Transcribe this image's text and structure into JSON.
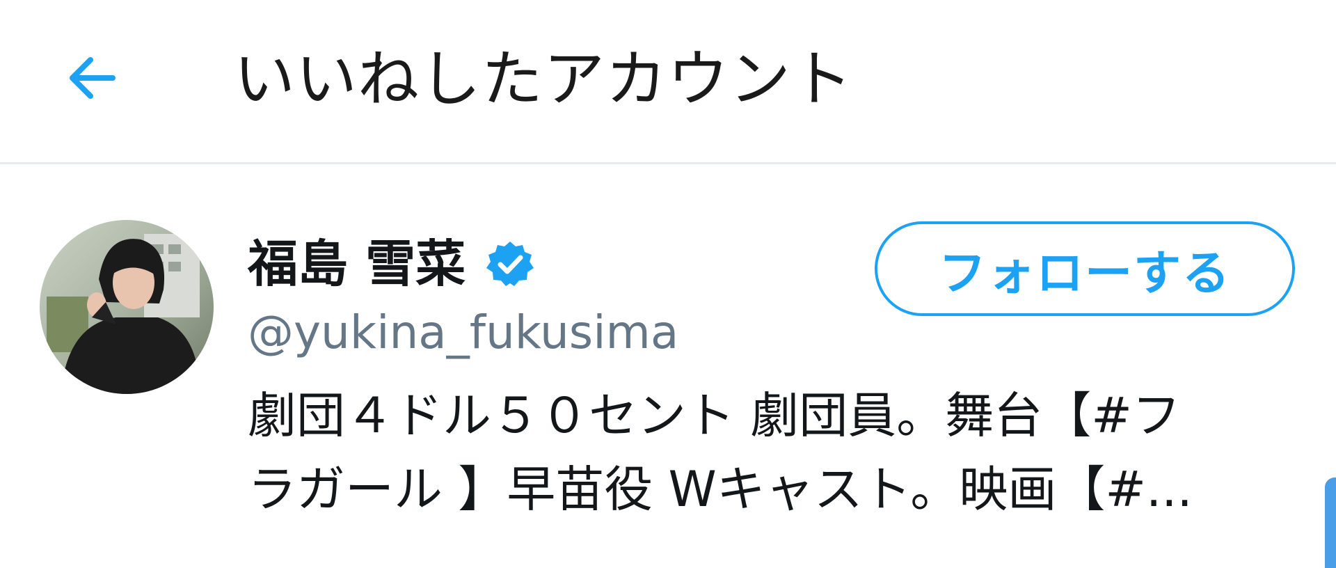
{
  "header": {
    "title": "いいねしたアカウント",
    "back_icon": "arrow-left-icon",
    "accent_color": "#1da1f2"
  },
  "user": {
    "avatar_icon": "profile-photo",
    "name": "福島 雪菜",
    "verified_icon": "verified-badge-icon",
    "handle": "@yukina_fukusima",
    "follow_label": "フォローする",
    "bio_lines": [
      "劇団４ドル５０セント 劇団員。舞台【#フ",
      "ラガール 】早苗役 Wキャスト。映画【#..."
    ]
  },
  "colors": {
    "text_primary": "#14171a",
    "text_secondary": "#657786",
    "divider": "#e6ecf0",
    "accent": "#1da1f2"
  }
}
